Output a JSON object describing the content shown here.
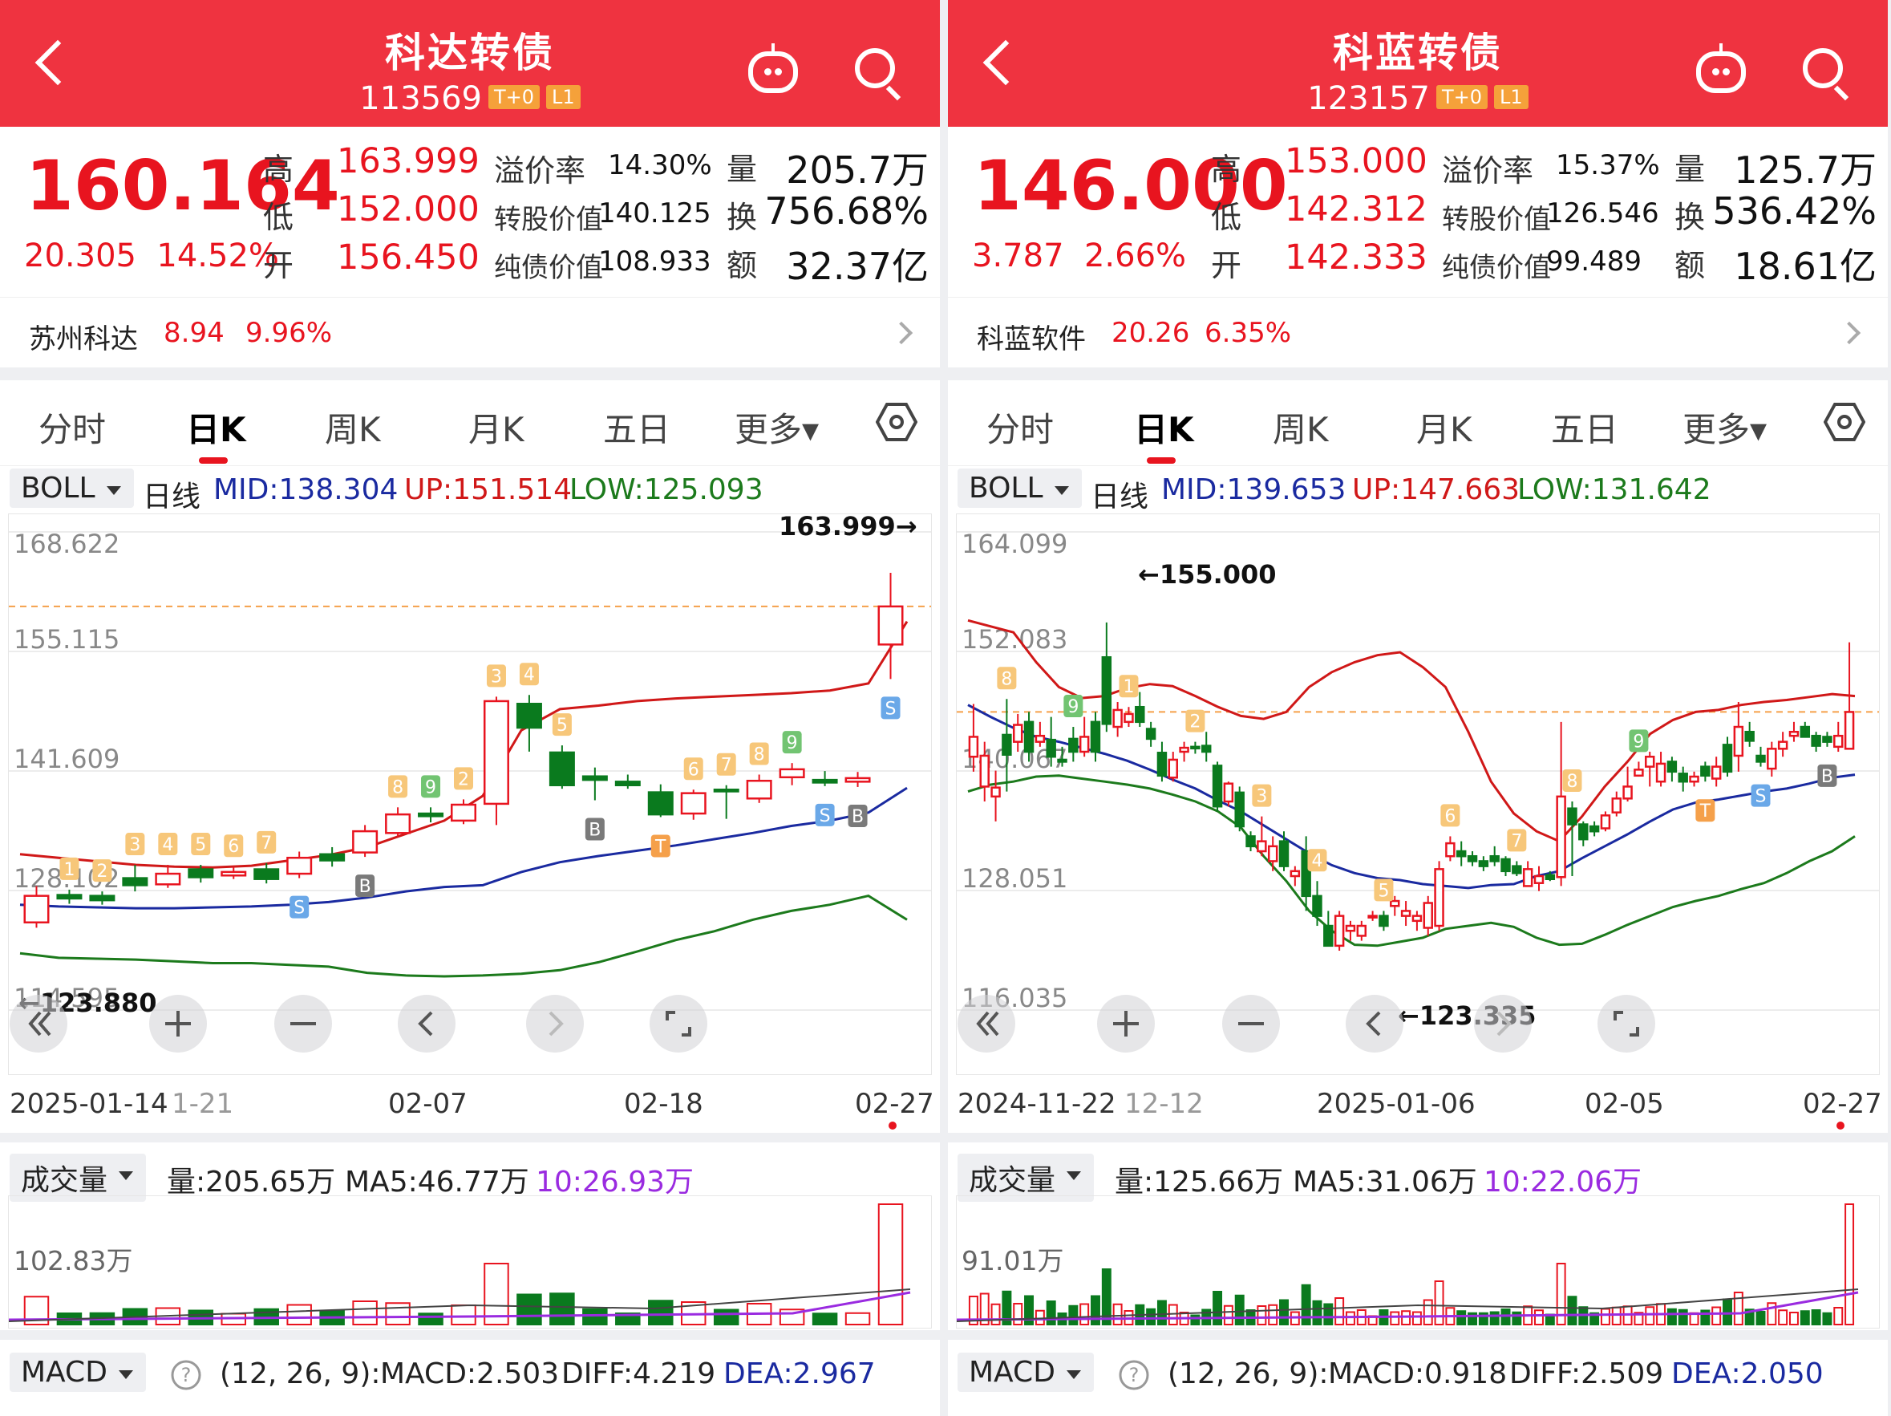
{
  "panels": [
    {
      "title": "科达转债",
      "code": "113569",
      "tags": [
        "T+0",
        "L1"
      ],
      "price": "160.164",
      "change": "20.305",
      "change_pct": "14.52%",
      "high_label": "高",
      "high": "163.999",
      "low_label": "低",
      "low": "152.000",
      "open_label": "开",
      "open": "156.450",
      "premium_label": "溢价率",
      "premium": "14.30%",
      "conv_label": "转股价值",
      "conv": "140.125",
      "bond_label": "纯债价值",
      "bond": "108.933",
      "vol_label": "量",
      "vol": "205.7万",
      "turn_label": "换",
      "turn": "756.68%",
      "amt_label": "额",
      "amt": "32.37亿",
      "stock_name": "苏州科达",
      "stock_price": "8.94",
      "stock_pct": "9.96%",
      "tabs": [
        "分时",
        "日K",
        "周K",
        "月K",
        "五日",
        "更多▾"
      ],
      "active_tab": 1,
      "boll": {
        "name": "BOLL",
        "period": "日线",
        "mid": "MID:138.304",
        "up": "UP:151.514",
        "low": "LOW:125.093"
      },
      "y_ticks": [
        "168.622",
        "155.115",
        "141.609",
        "128.102",
        "114.595"
      ],
      "high_mark": "163.999→",
      "low_mark": "←123.880",
      "x_labels": [
        "2025-01-14",
        "1-21",
        "02-07",
        "02-18",
        "02-27"
      ],
      "volume": {
        "name": "成交量",
        "vol": "量:205.65万",
        "ma5": "MA5:46.77万",
        "ma10": "10:26.93万",
        "tick": "102.83万"
      },
      "macd": {
        "name": "MACD",
        "params": "(12, 26, 9):",
        "macd": "MACD:2.503",
        "diff": "DIFF:4.219",
        "dea": "DEA:2.967"
      }
    },
    {
      "title": "科蓝转债",
      "code": "123157",
      "tags": [
        "T+0",
        "L1"
      ],
      "price": "146.000",
      "change": "3.787",
      "change_pct": "2.66%",
      "high_label": "高",
      "high": "153.000",
      "low_label": "低",
      "low": "142.312",
      "open_label": "开",
      "open": "142.333",
      "premium_label": "溢价率",
      "premium": "15.37%",
      "conv_label": "转股价值",
      "conv": "126.546",
      "bond_label": "纯债价值",
      "bond": "99.489",
      "vol_label": "量",
      "vol": "125.7万",
      "turn_label": "换",
      "turn": "536.42%",
      "amt_label": "额",
      "amt": "18.61亿",
      "stock_name": "科蓝软件",
      "stock_price": "20.26",
      "stock_pct": "6.35%",
      "tabs": [
        "分时",
        "日K",
        "周K",
        "月K",
        "五日",
        "更多▾"
      ],
      "active_tab": 1,
      "boll": {
        "name": "BOLL",
        "period": "日线",
        "mid": "MID:139.653",
        "up": "UP:147.663",
        "low": "LOW:131.642"
      },
      "y_ticks": [
        "164.099",
        "152.083",
        "140.067",
        "128.051",
        "116.035"
      ],
      "high_mark": "←155.000",
      "low_mark": "←123.335",
      "x_labels": [
        "2024-11-22",
        "12-12",
        "2025-01-06",
        "02-05",
        "02-27"
      ],
      "volume": {
        "name": "成交量",
        "vol": "量:125.66万",
        "ma5": "MA5:31.06万",
        "ma10": "10:22.06万",
        "tick": "91.01万"
      },
      "macd": {
        "name": "MACD",
        "params": "(12, 26, 9):",
        "macd": "MACD:0.918",
        "diff": "DIFF:2.509",
        "dea": "DEA:2.050"
      }
    }
  ],
  "colors": {
    "header": "#ef3340",
    "up": "#e8141f",
    "down": "#0a7a1e",
    "mid_line": "#1a2aa0",
    "up_line": "#d01818",
    "low_line": "#1c7a1c",
    "ma10": "#9a2be0"
  },
  "icons": [
    "back-icon",
    "robot-icon",
    "search-icon",
    "settings-hex-icon",
    "chevron-right-icon",
    "double-left-icon",
    "zoom-in-icon",
    "zoom-out-icon",
    "prev-icon",
    "next-icon",
    "fullscreen-icon",
    "help-icon"
  ],
  "chart_data": [
    {
      "type": "candlestick",
      "title": "科达转债 日K",
      "ylim": [
        114.595,
        168.622
      ],
      "y_ticks": [
        168.622,
        155.115,
        141.609,
        128.102,
        114.595
      ],
      "candles": [
        [
          124.5,
          127.5,
          128.6,
          123.9
        ],
        [
          127.6,
          127.2,
          128.2,
          126.6
        ],
        [
          127.5,
          127.0,
          128.0,
          126.5
        ],
        [
          129.5,
          128.7,
          131.0,
          128.0
        ],
        [
          128.8,
          130.0,
          131.0,
          128.4
        ],
        [
          130.5,
          129.6,
          131.0,
          129.0
        ],
        [
          129.8,
          130.2,
          130.8,
          129.4
        ],
        [
          130.5,
          129.4,
          131.2,
          128.9
        ],
        [
          130.0,
          131.8,
          132.5,
          129.5
        ],
        [
          132.2,
          131.5,
          133.0,
          130.8
        ],
        [
          132.4,
          134.8,
          135.5,
          131.9
        ],
        [
          134.6,
          136.7,
          137.5,
          134.2
        ],
        [
          136.8,
          136.5,
          137.5,
          135.8
        ],
        [
          136.0,
          137.8,
          138.4,
          135.6
        ],
        [
          137.9,
          149.5,
          150.0,
          135.5
        ],
        [
          149.2,
          146.5,
          150.2,
          143.8
        ],
        [
          143.7,
          140.0,
          144.5,
          139.6
        ],
        [
          141.0,
          140.6,
          142.0,
          138.3
        ],
        [
          140.4,
          140.0,
          141.2,
          139.6
        ],
        [
          139.2,
          136.7,
          140.1,
          136.4
        ],
        [
          136.8,
          139.1,
          139.5,
          136.1
        ],
        [
          139.5,
          139.3,
          140.0,
          136.2
        ],
        [
          138.5,
          140.5,
          141.2,
          138.0
        ],
        [
          140.9,
          141.8,
          142.5,
          140.0
        ],
        [
          140.6,
          140.3,
          141.6,
          139.9
        ],
        [
          140.4,
          140.8,
          141.5,
          139.8
        ],
        [
          155.9,
          160.2,
          164.0,
          152.0
        ]
      ],
      "boll_up": [
        132.2,
        131.8,
        131.4,
        131.0,
        130.8,
        130.7,
        130.9,
        131.5,
        132.1,
        133.0,
        134.5,
        136.0,
        138.8,
        146.2,
        148.6,
        149.0,
        149.5,
        149.8,
        150.0,
        150.2,
        150.4,
        150.7,
        151.5,
        158.5
      ],
      "boll_mid": [
        126.5,
        126.3,
        126.2,
        126.1,
        126.1,
        126.2,
        126.3,
        126.5,
        126.8,
        127.3,
        128.0,
        128.5,
        128.7,
        130.2,
        131.3,
        132.0,
        132.6,
        133.2,
        133.9,
        134.6,
        135.4,
        136.0,
        136.9,
        139.7
      ],
      "boll_low": [
        121.0,
        120.5,
        120.4,
        120.3,
        120.1,
        119.9,
        119.9,
        119.7,
        119.5,
        118.8,
        118.5,
        118.4,
        118.5,
        118.7,
        119.1,
        120.0,
        121.2,
        122.5,
        123.5,
        124.8,
        125.8,
        126.5,
        127.5,
        124.8
      ],
      "signals": [
        "1",
        "2",
        "3",
        "4",
        "5",
        "6",
        "7",
        "S",
        "B",
        "8",
        "9",
        "2",
        "3",
        "4",
        "5",
        "B",
        "T",
        "6",
        "7",
        "8",
        "9",
        "S",
        "B",
        "S"
      ]
    },
    {
      "type": "candlestick",
      "title": "科蓝转债 日K",
      "ylim": [
        116.035,
        164.099
      ],
      "y_ticks": [
        164.099,
        152.083,
        140.067,
        128.051,
        116.035
      ],
      "candles": [
        [
          141.5,
          143.5,
          146.8,
          140.0
        ],
        [
          138.5,
          141.6,
          143.0,
          137.0
        ],
        [
          137.5,
          138.4,
          140.1,
          135.0
        ],
        [
          143.7,
          141.7,
          147.3,
          138.0
        ],
        [
          143.0,
          144.7,
          145.8,
          142.0
        ],
        [
          145.0,
          142.0,
          146.0,
          141.0
        ],
        [
          143.0,
          143.6,
          145.0,
          142.5
        ],
        [
          143.2,
          141.5,
          145.5,
          140.5
        ],
        [
          141.2,
          141.0,
          142.5,
          140.5
        ],
        [
          143.3,
          142.0,
          144.5,
          141.0
        ],
        [
          142.0,
          143.5,
          145.5,
          141.5
        ],
        [
          145.0,
          142.0,
          146.0,
          141.0
        ],
        [
          151.5,
          144.8,
          155.0,
          144.0
        ],
        [
          144.5,
          146.2,
          147.0,
          143.5
        ],
        [
          145.0,
          145.8,
          146.5,
          144.5
        ],
        [
          146.5,
          145.0,
          148.0,
          144.5
        ],
        [
          144.3,
          143.3,
          145.0,
          142.5
        ],
        [
          141.9,
          139.6,
          143.0,
          139.0
        ],
        [
          139.4,
          141.2,
          142.0,
          139.0
        ],
        [
          142.0,
          142.4,
          143.0,
          141.0
        ],
        [
          142.5,
          142.4,
          143.0,
          141.8
        ],
        [
          142.6,
          142.0,
          144.0,
          141.0
        ],
        [
          140.6,
          136.5,
          141.0,
          136.0
        ],
        [
          137.0,
          138.8,
          139.0,
          136.5
        ],
        [
          137.9,
          134.5,
          138.5,
          134.0
        ],
        [
          133.5,
          132.5,
          134.0,
          132.0
        ],
        [
          132.0,
          133.0,
          135.5,
          131.5
        ],
        [
          131.0,
          132.5,
          133.5,
          130.0
        ],
        [
          133.0,
          130.5,
          134.0,
          130.0
        ],
        [
          129.5,
          130.0,
          130.5,
          128.5
        ],
        [
          132.0,
          127.5,
          133.5,
          126.0
        ],
        [
          127.5,
          125.5,
          129.0,
          124.5
        ],
        [
          124.5,
          122.5,
          126.0,
          123.0
        ],
        [
          122.5,
          125.5,
          126.0,
          122.0
        ],
        [
          124.0,
          124.5,
          125.0,
          123.0
        ],
        [
          123.5,
          124.5,
          125.0,
          123.0
        ],
        [
          125.5,
          125.5,
          126.0,
          125.0
        ],
        [
          125.5,
          124.5,
          126.0,
          124.0
        ],
        [
          126.5,
          127.0,
          127.5,
          125.5
        ],
        [
          125.5,
          126.0,
          127.0,
          124.5
        ],
        [
          125.0,
          125.5,
          126.0,
          124.0
        ],
        [
          124.3,
          126.8,
          127.5,
          123.5
        ],
        [
          124.5,
          130.2,
          131.0,
          124.0
        ],
        [
          131.5,
          132.8,
          133.5,
          131.0
        ],
        [
          132.0,
          131.5,
          133.0,
          130.5
        ],
        [
          131.5,
          131.0,
          132.0,
          130.5
        ],
        [
          131.0,
          130.5,
          131.5,
          130.0
        ],
        [
          131.5,
          131.0,
          132.5,
          130.5
        ],
        [
          131.2,
          130.0,
          131.5,
          129.5
        ],
        [
          130.5,
          129.8,
          131.0,
          129.5
        ],
        [
          128.5,
          130.2,
          131.0,
          128.5
        ],
        [
          128.8,
          129.5,
          130.5,
          128.0
        ],
        [
          129.6,
          129.2,
          130.0,
          129.0
        ],
        [
          129.4,
          137.5,
          145.0,
          128.5
        ],
        [
          136.3,
          134.7,
          137.0,
          129.5
        ],
        [
          134.7,
          133.2,
          135.0,
          132.5
        ],
        [
          134.5,
          134.0,
          135.0,
          133.5
        ],
        [
          134.3,
          135.6,
          136.0,
          134.0
        ],
        [
          135.9,
          137.3,
          138.0,
          135.5
        ],
        [
          137.3,
          138.5,
          140.5,
          137.0
        ],
        [
          139.6,
          140.2,
          141.0,
          139.5
        ],
        [
          140.5,
          141.5,
          142.0,
          138.5
        ],
        [
          139.0,
          140.8,
          142.0,
          138.5
        ],
        [
          141.0,
          140.0,
          141.5,
          139.0
        ],
        [
          139.8,
          139.0,
          140.5,
          138.0
        ],
        [
          139.0,
          139.5,
          140.0,
          138.5
        ],
        [
          140.5,
          139.6,
          141.0,
          139.0
        ],
        [
          139.3,
          140.5,
          141.5,
          138.5
        ],
        [
          142.7,
          140.0,
          143.5,
          139.5
        ],
        [
          141.6,
          144.5,
          147.0,
          140.0
        ],
        [
          144.0,
          143.1,
          145.0,
          142.5
        ],
        [
          141.6,
          141.0,
          142.5,
          140.5
        ],
        [
          140.3,
          142.3,
          143.0,
          139.5
        ],
        [
          142.3,
          143.0,
          144.0,
          141.5
        ],
        [
          143.6,
          144.0,
          145.0,
          143.0
        ],
        [
          144.5,
          143.5,
          145.0,
          143.5
        ],
        [
          143.6,
          142.6,
          144.0,
          142.0
        ],
        [
          143.5,
          143.0,
          144.0,
          142.5
        ],
        [
          142.5,
          143.6,
          145.0,
          142.0
        ],
        [
          142.3,
          146.0,
          153.0,
          142.3
        ]
      ],
      "boll_up": [
        155.2,
        154.6,
        154.0,
        151.0,
        148.5,
        147.4,
        147.6,
        148.4,
        148.8,
        148.6,
        147.6,
        146.5,
        145.6,
        145.3,
        146.0,
        148.5,
        150.0,
        151.0,
        151.7,
        152.0,
        150.5,
        148.5,
        144.0,
        139.0,
        135.8,
        134.0,
        133.0,
        135.5,
        138.5,
        141.0,
        143.8,
        145.2,
        146.0,
        146.2,
        146.7,
        147.0,
        147.2,
        147.5,
        147.8,
        147.6
      ],
      "boll_mid": [
        146.7,
        145.5,
        144.4,
        143.5,
        143.0,
        142.4,
        141.8,
        141.1,
        140.2,
        139.2,
        138.3,
        137.1,
        136.0,
        134.6,
        133.2,
        131.8,
        130.6,
        129.8,
        129.3,
        129.1,
        128.7,
        128.5,
        128.3,
        128.6,
        128.7,
        129.5,
        130.0,
        131.3,
        132.5,
        133.7,
        135.0,
        136.2,
        136.9,
        137.2,
        137.6,
        138.0,
        138.3,
        138.8,
        139.4,
        139.7
      ],
      "boll_low": [
        138.0,
        138.7,
        139.0,
        139.5,
        139.6,
        139.3,
        139.0,
        138.7,
        138.3,
        137.7,
        137.0,
        136.0,
        134.4,
        131.5,
        129.0,
        126.0,
        124.0,
        122.6,
        122.5,
        122.9,
        123.3,
        124.2,
        124.5,
        124.8,
        124.4,
        123.3,
        122.6,
        122.7,
        123.6,
        124.6,
        125.5,
        126.4,
        127.0,
        127.5,
        128.2,
        128.8,
        129.8,
        131.0,
        132.0,
        133.5
      ],
      "signals": [
        "8",
        "9",
        "1",
        "2",
        "3",
        "4",
        "5",
        "6",
        "7",
        "8",
        "9",
        "T",
        "S",
        "B"
      ]
    }
  ]
}
